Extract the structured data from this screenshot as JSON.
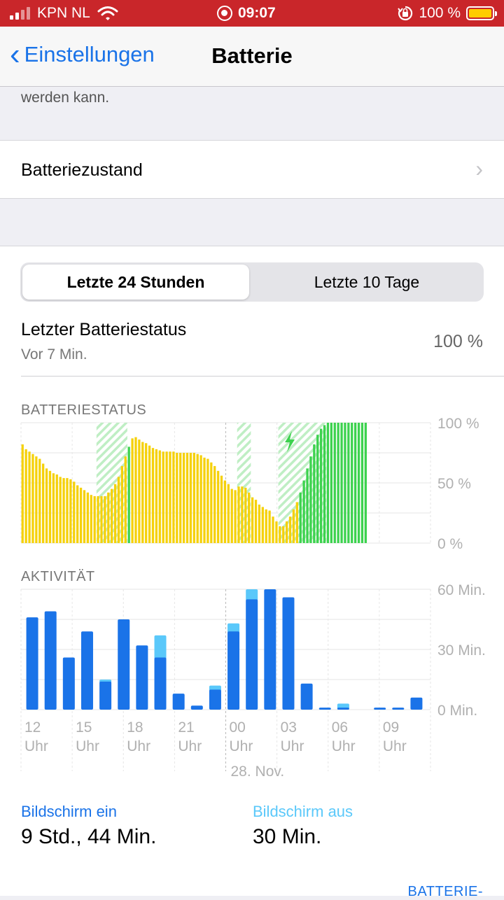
{
  "status_bar": {
    "carrier": "KPN NL",
    "time": "09:07",
    "battery_percent": "100 %"
  },
  "nav": {
    "back_label": "Einstellungen",
    "title": "Batterie"
  },
  "top_note": "werden kann.",
  "battery_health": {
    "label": "Batteriezustand"
  },
  "segmented": {
    "options": [
      "Letzte 24 Stunden",
      "Letzte 10 Tage"
    ],
    "selected": "Letzte 24 Stunden"
  },
  "last_status": {
    "title": "Letzter Batteriestatus",
    "subtitle": "Vor 7 Min.",
    "value": "100 %"
  },
  "colors": {
    "accent": "#1a73e8",
    "battery_yellow": "#f5d10a",
    "battery_green": "#3cd24e",
    "screen_on": "#1a73e8",
    "screen_off": "#5ac8fa",
    "statusbar": "#c9262a"
  },
  "chart_data": [
    {
      "type": "bar",
      "title": "BATTERIESTATUS",
      "y_ticks": [
        "100 %",
        "50 %",
        "0 %"
      ],
      "ylim": [
        0,
        100
      ],
      "charging_label": "charging-bolt",
      "series": [
        {
          "values": [
            82,
            78,
            76,
            74,
            72,
            70,
            66,
            62,
            60,
            58,
            57,
            55,
            54,
            54,
            53,
            51,
            48,
            46,
            44,
            42,
            40,
            39,
            39,
            39,
            39,
            42,
            45,
            49,
            55,
            64,
            72,
            80,
            87,
            88,
            86,
            84,
            83,
            81,
            79,
            78,
            77,
            76,
            76,
            76,
            76,
            75,
            75,
            75,
            75,
            75,
            75,
            74,
            73,
            71,
            70,
            67,
            64,
            60,
            56,
            52,
            49,
            45,
            44,
            47,
            47,
            46,
            42,
            38,
            36,
            32,
            30,
            28,
            27,
            22,
            18,
            14,
            14,
            18,
            22,
            28,
            34,
            42,
            52,
            62,
            72,
            82,
            90,
            95,
            98,
            100,
            100,
            100,
            100,
            100,
            100,
            100,
            100,
            100,
            100,
            100,
            100
          ],
          "state": [
            "u",
            "u",
            "u",
            "u",
            "u",
            "u",
            "u",
            "u",
            "u",
            "u",
            "u",
            "u",
            "u",
            "u",
            "u",
            "u",
            "u",
            "u",
            "u",
            "u",
            "u",
            "u",
            "u",
            "u",
            "u",
            "u",
            "u",
            "u",
            "u",
            "u",
            "u",
            "c",
            "u",
            "u",
            "u",
            "u",
            "u",
            "u",
            "u",
            "u",
            "u",
            "u",
            "u",
            "u",
            "u",
            "u",
            "u",
            "u",
            "u",
            "u",
            "u",
            "u",
            "u",
            "u",
            "u",
            "u",
            "u",
            "u",
            "u",
            "u",
            "u",
            "u",
            "u",
            "u",
            "u",
            "u",
            "u",
            "u",
            "u",
            "u",
            "u",
            "u",
            "u",
            "u",
            "u",
            "u",
            "u",
            "u",
            "u",
            "u",
            "u",
            "c",
            "c",
            "c",
            "c",
            "c",
            "c",
            "c",
            "c",
            "c",
            "c",
            "c",
            "c",
            "c",
            "c",
            "c",
            "c",
            "c",
            "c",
            "c",
            "c"
          ]
        }
      ],
      "charging_windows": [
        [
          22,
          30
        ],
        [
          63,
          66
        ],
        [
          75,
          88
        ]
      ]
    },
    {
      "type": "bar",
      "title": "AKTIVITÄT",
      "y_ticks": [
        "60 Min.",
        "30 Min.",
        "0 Min."
      ],
      "ylim": [
        0,
        60
      ],
      "categories": [
        "12 Uhr",
        "",
        "",
        "15 Uhr",
        "",
        "",
        "18 Uhr",
        "",
        "",
        "21 Uhr",
        "",
        "",
        "00 Uhr",
        "",
        "",
        "03 Uhr",
        "",
        "",
        "06 Uhr",
        "",
        "",
        "09 Uhr",
        "",
        ""
      ],
      "series": [
        {
          "name": "Bildschirm ein",
          "values": [
            46,
            49,
            26,
            39,
            14,
            45,
            32,
            26,
            8,
            2,
            10,
            39,
            55,
            60,
            56,
            13,
            1,
            1,
            0,
            1,
            1,
            6
          ]
        },
        {
          "name": "Bildschirm aus",
          "values": [
            0,
            0,
            0,
            0,
            1,
            0,
            0,
            11,
            0,
            0,
            2,
            4,
            5,
            0,
            0,
            0,
            0,
            2,
            0,
            0,
            0,
            0
          ]
        }
      ],
      "x_labels": [
        {
          "hour": "12",
          "unit": "Uhr"
        },
        {
          "hour": "15",
          "unit": "Uhr"
        },
        {
          "hour": "18",
          "unit": "Uhr"
        },
        {
          "hour": "21",
          "unit": "Uhr"
        },
        {
          "hour": "00",
          "unit": "Uhr"
        },
        {
          "hour": "03",
          "unit": "Uhr"
        },
        {
          "hour": "06",
          "unit": "Uhr"
        },
        {
          "hour": "09",
          "unit": "Uhr"
        }
      ],
      "date_label": "28. Nov."
    }
  ],
  "summary": {
    "screen_on_label": "Bildschirm ein",
    "screen_on_value": "9 Std., 44 Min.",
    "screen_off_label": "Bildschirm aus",
    "screen_off_value": "30 Min."
  },
  "footer_link": "BATTERIE-"
}
